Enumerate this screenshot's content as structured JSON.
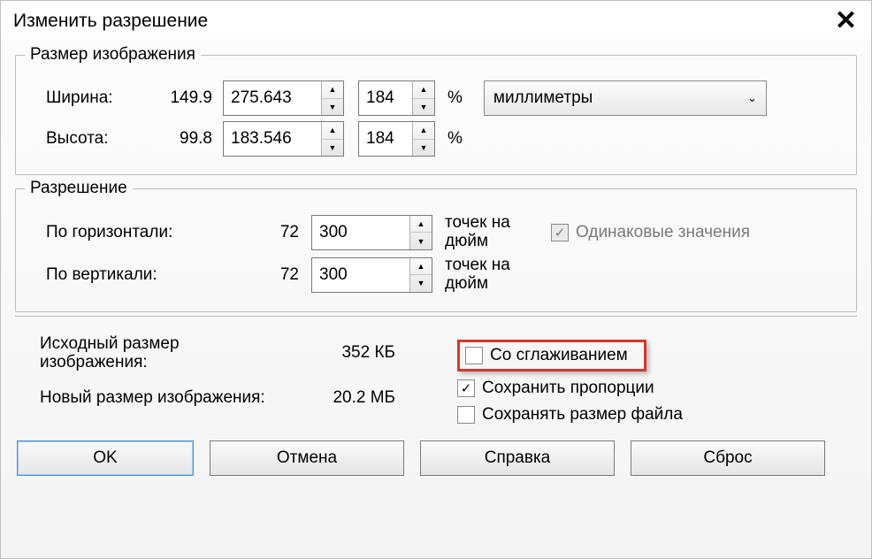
{
  "title": "Изменить разрешение",
  "image_size": {
    "legend": "Размер изображения",
    "width_label": "Ширина:",
    "width_old": "149.9",
    "width_new": "275.643",
    "width_pct": "184",
    "pct_symbol": "%",
    "height_label": "Высота:",
    "height_old": "99.8",
    "height_new": "183.546",
    "height_pct": "184",
    "unit_selected": "миллиметры"
  },
  "resolution": {
    "legend": "Разрешение",
    "horiz_label": "По горизонтали:",
    "horiz_old": "72",
    "horiz_new": "300",
    "vert_label": "По вертикали:",
    "vert_old": "72",
    "vert_new": "300",
    "dpi_label": "точек на дюйм",
    "same_label": "Одинаковые значения"
  },
  "info": {
    "orig_label": "Исходный размер изображения:",
    "orig_val": "352 КБ",
    "new_label": "Новый размер изображения:",
    "new_val": "20.2 МБ",
    "antialias_label": "Со сглаживанием",
    "keep_prop_label": "Сохранить пропорции",
    "keep_file_label": "Сохранять размер файла"
  },
  "buttons": {
    "ok": "OK",
    "cancel": "Отмена",
    "help": "Справка",
    "reset": "Сброс"
  }
}
